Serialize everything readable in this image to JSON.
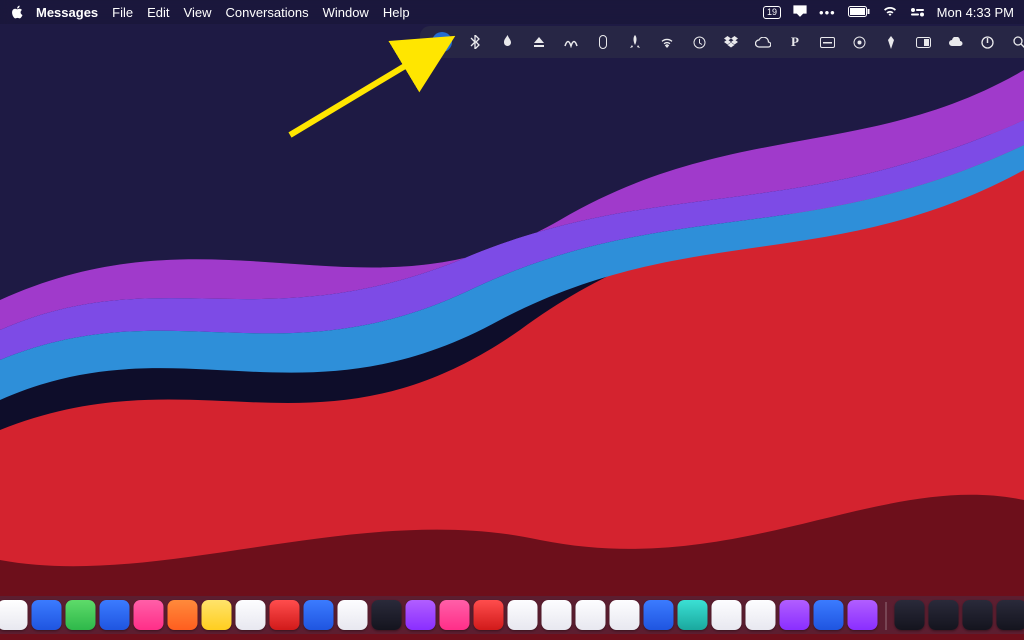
{
  "menubar": {
    "app": "Messages",
    "items": [
      "File",
      "Edit",
      "View",
      "Conversations",
      "Window",
      "Help"
    ]
  },
  "status": {
    "date_badge": "19",
    "clock": "Mon 4:33 PM"
  },
  "tray_icons": [
    "drive-icon",
    "bluetooth-icon",
    "flame-icon",
    "eject-icon",
    "swirl-icon",
    "mouse-icon",
    "rocket-icon",
    "wifi-signal-icon",
    "clock-icon",
    "dropbox-icon",
    "creative-cloud-icon",
    "p-icon",
    "card-icon",
    "target-icon",
    "launch-icon",
    "screen-icon",
    "cloud-blob-icon",
    "power-icon",
    "search-icon"
  ],
  "status_icons": [
    "airplay-icon",
    "more-icon",
    "battery-icon",
    "wifi-icon",
    "control-center-icon"
  ],
  "dock_icons": [
    "finder",
    "safari",
    "messages",
    "mail",
    "blue",
    "green",
    "blue",
    "pink",
    "orange",
    "yellow",
    "white",
    "red",
    "blue",
    "white",
    "dark",
    "purple",
    "pink",
    "red",
    "white",
    "white",
    "white",
    "white",
    "blue",
    "teal",
    "white",
    "white",
    "purple",
    "blue",
    "purple"
  ],
  "dock_right": [
    "dark",
    "dark",
    "dark",
    "dark",
    "dark",
    "dark",
    "trash"
  ],
  "annotation": {
    "arrow_color": "#ffe600"
  }
}
